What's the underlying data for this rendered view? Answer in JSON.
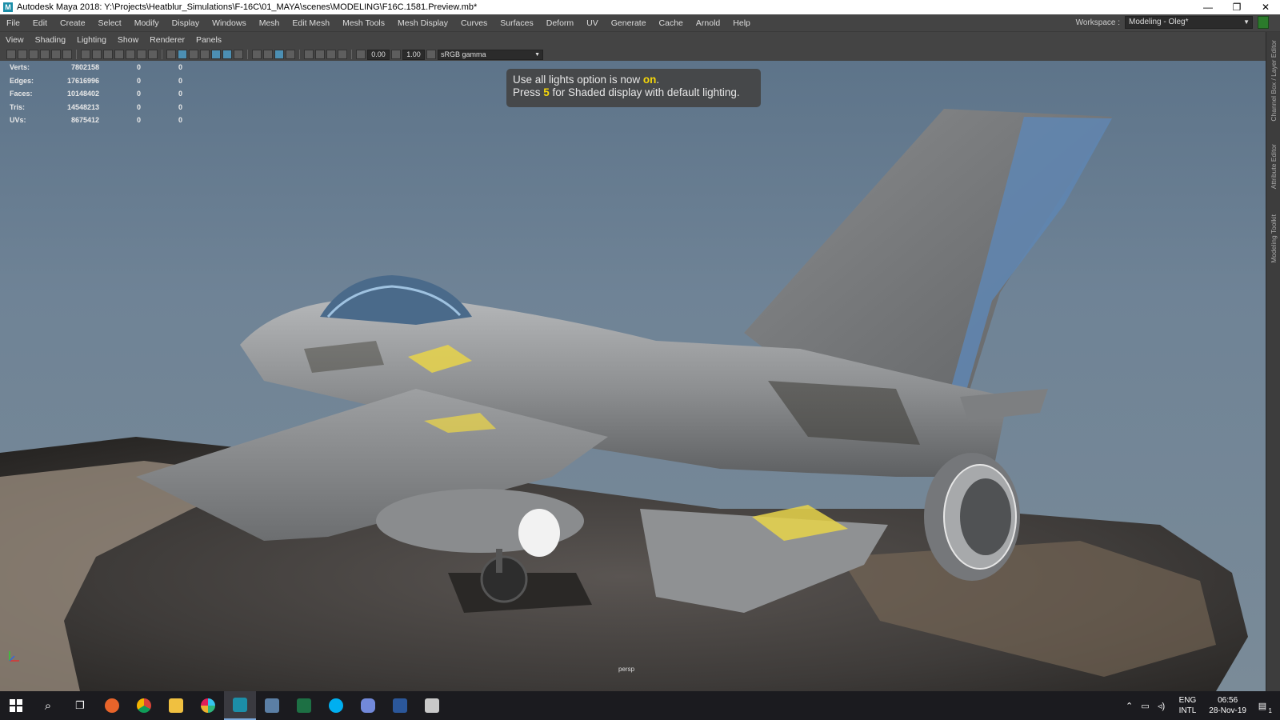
{
  "window": {
    "title": "Autodesk Maya 2018: Y:\\Projects\\Heatblur_Simulations\\F-16C\\01_MAYA\\scenes\\MODELING\\F16C.1581.Preview.mb*",
    "minimize": "—",
    "restore": "❐",
    "close": "✕"
  },
  "menu": [
    "File",
    "Edit",
    "Create",
    "Select",
    "Modify",
    "Display",
    "Windows",
    "Mesh",
    "Edit Mesh",
    "Mesh Tools",
    "Mesh Display",
    "Curves",
    "Surfaces",
    "Deform",
    "UV",
    "Generate",
    "Cache",
    "Arnold",
    "Help"
  ],
  "workspace": {
    "label": "Workspace :",
    "value": "Modeling - Oleg*"
  },
  "side_tabs": [
    "Channel Box / Layer Editor",
    "Attribute Editor",
    "Modeling Toolkit"
  ],
  "panel_menu": [
    "View",
    "Shading",
    "Lighting",
    "Show",
    "Renderer",
    "Panels"
  ],
  "toolbar": {
    "exposure": "0.00",
    "gamma": "1.00",
    "color_space": "sRGB gamma"
  },
  "hud": [
    {
      "label": "Verts:",
      "v0": "7802158",
      "v1": "0",
      "v2": "0"
    },
    {
      "label": "Edges:",
      "v0": "17616996",
      "v1": "0",
      "v2": "0"
    },
    {
      "label": "Faces:",
      "v0": "10148402",
      "v1": "0",
      "v2": "0"
    },
    {
      "label": "Tris:",
      "v0": "14548213",
      "v1": "0",
      "v2": "0"
    },
    {
      "label": "UVs:",
      "v0": "8675412",
      "v1": "0",
      "v2": "0"
    }
  ],
  "banner": {
    "line1_pre": "Use all lights option is now ",
    "line1_hl": "on",
    "line1_post": ".",
    "line2_pre": "Press ",
    "line2_hl": "5",
    "line2_post": " for Shaded display with default lighting."
  },
  "camera": "persp",
  "taskbar": {
    "apps": [
      "start",
      "search",
      "task-view",
      "firefox",
      "chrome",
      "file-explorer",
      "slack",
      "maya",
      "app-window",
      "excel",
      "skype",
      "discord",
      "word",
      "app-generic"
    ],
    "lang1": "ENG",
    "lang2": "INTL",
    "time": "06:56",
    "date": "28-Nov-19",
    "notif_count": "1"
  },
  "colors": {
    "accent_yellow": "#f5d70a",
    "viewport_top": "#5b7288",
    "active_blue": "#4c8fb3"
  }
}
